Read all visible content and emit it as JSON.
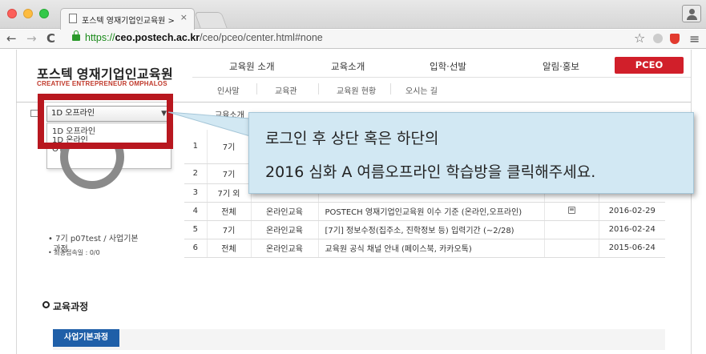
{
  "browser": {
    "tab_title": "포스텍 영재기업인교육원 > PCE",
    "tab_close": "×",
    "url_scheme": "https://",
    "url_host": "ceo.postech.ac.kr",
    "url_path": "/ceo/pceo/center.html#none",
    "star": "☆",
    "menu": "≡",
    "back": "←",
    "forward": "→",
    "reload": "C"
  },
  "site": {
    "logo_title": "포스텍 영재기업인교육원",
    "logo_sub": "CREATIVE ENTREPRENEUR OMPHALOS",
    "gnb": [
      "교육원 소개",
      "교육소개",
      "입학·선발",
      "알림·홍보"
    ],
    "pceo_label": "PCEO",
    "sub_nav": [
      "인사말",
      "교육관",
      "교육원 현황",
      "오시는 길"
    ]
  },
  "sidebar": {
    "select_value": "1D 오프라인",
    "options": [
      "1D 오프라인",
      "1D 온라인",
      "OT"
    ],
    "user_info": "7기 p07test / 사업기본",
    "user_info_2": "과정",
    "user_info_3": "최종접속일 : 0/0"
  },
  "board": {
    "tab_label": "교육소개",
    "rows": [
      {
        "no": "1",
        "gen": "7기",
        "type": "",
        "title": "",
        "file": false,
        "date": ""
      },
      {
        "no": "2",
        "gen": "7기",
        "type": "",
        "title": "",
        "file": false,
        "date": ""
      },
      {
        "no": "3",
        "gen": "7기 외",
        "type": "",
        "title": "",
        "file": false,
        "date": ""
      },
      {
        "no": "4",
        "gen": "전체",
        "type": "온라인교육",
        "title": "POSTECH 영재기업인교육원 이수 기준 (온라인,오프라인)",
        "file": true,
        "date": "2016-02-29"
      },
      {
        "no": "5",
        "gen": "7기",
        "type": "온라인교육",
        "title": "[7기] 정보수정(집주소, 진학정보 등) 입력기간 (~2/28)",
        "file": false,
        "date": "2016-02-24"
      },
      {
        "no": "6",
        "gen": "전체",
        "type": "온라인교육",
        "title": "교육원 공식 채널 안내 (페이스북, 카카오톡)",
        "file": false,
        "date": "2015-06-24"
      }
    ]
  },
  "tooltip": {
    "line1": "로그인 후 상단 혹은 하단의",
    "line2": "2016 심화 A 여름오프라인 학습방을 클릭해주세요."
  },
  "course": {
    "heading": "교육과정",
    "tag": "사업기본과정"
  },
  "colors": {
    "accent_red": "#d11f2a",
    "highlight_box": "#b8171f",
    "tooltip_bg": "#d2e8f3",
    "course_blue": "#1f5fa8"
  }
}
